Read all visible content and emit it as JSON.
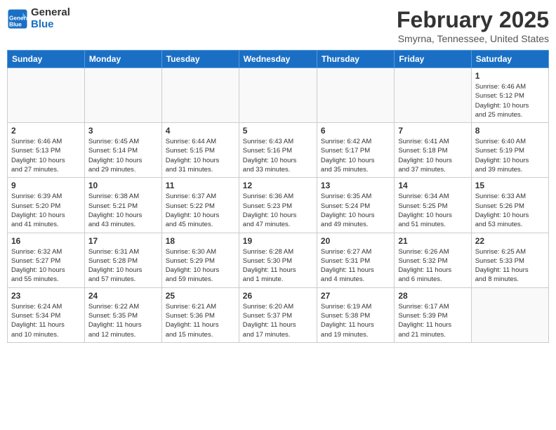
{
  "header": {
    "logo_line1": "General",
    "logo_line2": "Blue",
    "month": "February 2025",
    "location": "Smyrna, Tennessee, United States"
  },
  "weekdays": [
    "Sunday",
    "Monday",
    "Tuesday",
    "Wednesday",
    "Thursday",
    "Friday",
    "Saturday"
  ],
  "weeks": [
    [
      {
        "day": "",
        "info": ""
      },
      {
        "day": "",
        "info": ""
      },
      {
        "day": "",
        "info": ""
      },
      {
        "day": "",
        "info": ""
      },
      {
        "day": "",
        "info": ""
      },
      {
        "day": "",
        "info": ""
      },
      {
        "day": "1",
        "info": "Sunrise: 6:46 AM\nSunset: 5:12 PM\nDaylight: 10 hours\nand 25 minutes."
      }
    ],
    [
      {
        "day": "2",
        "info": "Sunrise: 6:46 AM\nSunset: 5:13 PM\nDaylight: 10 hours\nand 27 minutes."
      },
      {
        "day": "3",
        "info": "Sunrise: 6:45 AM\nSunset: 5:14 PM\nDaylight: 10 hours\nand 29 minutes."
      },
      {
        "day": "4",
        "info": "Sunrise: 6:44 AM\nSunset: 5:15 PM\nDaylight: 10 hours\nand 31 minutes."
      },
      {
        "day": "5",
        "info": "Sunrise: 6:43 AM\nSunset: 5:16 PM\nDaylight: 10 hours\nand 33 minutes."
      },
      {
        "day": "6",
        "info": "Sunrise: 6:42 AM\nSunset: 5:17 PM\nDaylight: 10 hours\nand 35 minutes."
      },
      {
        "day": "7",
        "info": "Sunrise: 6:41 AM\nSunset: 5:18 PM\nDaylight: 10 hours\nand 37 minutes."
      },
      {
        "day": "8",
        "info": "Sunrise: 6:40 AM\nSunset: 5:19 PM\nDaylight: 10 hours\nand 39 minutes."
      }
    ],
    [
      {
        "day": "9",
        "info": "Sunrise: 6:39 AM\nSunset: 5:20 PM\nDaylight: 10 hours\nand 41 minutes."
      },
      {
        "day": "10",
        "info": "Sunrise: 6:38 AM\nSunset: 5:21 PM\nDaylight: 10 hours\nand 43 minutes."
      },
      {
        "day": "11",
        "info": "Sunrise: 6:37 AM\nSunset: 5:22 PM\nDaylight: 10 hours\nand 45 minutes."
      },
      {
        "day": "12",
        "info": "Sunrise: 6:36 AM\nSunset: 5:23 PM\nDaylight: 10 hours\nand 47 minutes."
      },
      {
        "day": "13",
        "info": "Sunrise: 6:35 AM\nSunset: 5:24 PM\nDaylight: 10 hours\nand 49 minutes."
      },
      {
        "day": "14",
        "info": "Sunrise: 6:34 AM\nSunset: 5:25 PM\nDaylight: 10 hours\nand 51 minutes."
      },
      {
        "day": "15",
        "info": "Sunrise: 6:33 AM\nSunset: 5:26 PM\nDaylight: 10 hours\nand 53 minutes."
      }
    ],
    [
      {
        "day": "16",
        "info": "Sunrise: 6:32 AM\nSunset: 5:27 PM\nDaylight: 10 hours\nand 55 minutes."
      },
      {
        "day": "17",
        "info": "Sunrise: 6:31 AM\nSunset: 5:28 PM\nDaylight: 10 hours\nand 57 minutes."
      },
      {
        "day": "18",
        "info": "Sunrise: 6:30 AM\nSunset: 5:29 PM\nDaylight: 10 hours\nand 59 minutes."
      },
      {
        "day": "19",
        "info": "Sunrise: 6:28 AM\nSunset: 5:30 PM\nDaylight: 11 hours\nand 1 minute."
      },
      {
        "day": "20",
        "info": "Sunrise: 6:27 AM\nSunset: 5:31 PM\nDaylight: 11 hours\nand 4 minutes."
      },
      {
        "day": "21",
        "info": "Sunrise: 6:26 AM\nSunset: 5:32 PM\nDaylight: 11 hours\nand 6 minutes."
      },
      {
        "day": "22",
        "info": "Sunrise: 6:25 AM\nSunset: 5:33 PM\nDaylight: 11 hours\nand 8 minutes."
      }
    ],
    [
      {
        "day": "23",
        "info": "Sunrise: 6:24 AM\nSunset: 5:34 PM\nDaylight: 11 hours\nand 10 minutes."
      },
      {
        "day": "24",
        "info": "Sunrise: 6:22 AM\nSunset: 5:35 PM\nDaylight: 11 hours\nand 12 minutes."
      },
      {
        "day": "25",
        "info": "Sunrise: 6:21 AM\nSunset: 5:36 PM\nDaylight: 11 hours\nand 15 minutes."
      },
      {
        "day": "26",
        "info": "Sunrise: 6:20 AM\nSunset: 5:37 PM\nDaylight: 11 hours\nand 17 minutes."
      },
      {
        "day": "27",
        "info": "Sunrise: 6:19 AM\nSunset: 5:38 PM\nDaylight: 11 hours\nand 19 minutes."
      },
      {
        "day": "28",
        "info": "Sunrise: 6:17 AM\nSunset: 5:39 PM\nDaylight: 11 hours\nand 21 minutes."
      },
      {
        "day": "",
        "info": ""
      }
    ]
  ]
}
